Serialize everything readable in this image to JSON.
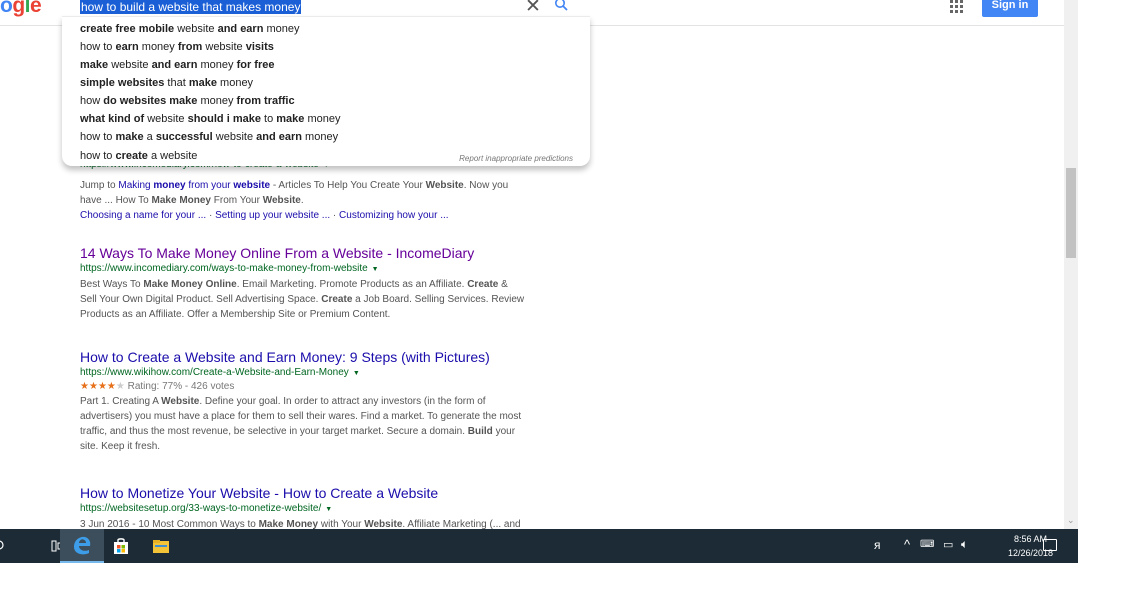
{
  "header": {
    "logo_text": "ogle",
    "search_query": "how to build a website that makes money",
    "clear_glyph": "✕",
    "signin_label": "Sign in"
  },
  "suggestions": [
    {
      "parts": [
        [
          "b",
          "create free mobile"
        ],
        [
          "n",
          " website "
        ],
        [
          "b",
          "and earn"
        ],
        [
          "n",
          " money"
        ]
      ]
    },
    {
      "parts": [
        [
          "n",
          "how to "
        ],
        [
          "b",
          "earn"
        ],
        [
          "n",
          " money "
        ],
        [
          "b",
          "from"
        ],
        [
          "n",
          " website "
        ],
        [
          "b",
          "visits"
        ]
      ]
    },
    {
      "parts": [
        [
          "b",
          "make"
        ],
        [
          "n",
          " website "
        ],
        [
          "b",
          "and earn"
        ],
        [
          "n",
          " money "
        ],
        [
          "b",
          "for free"
        ]
      ]
    },
    {
      "parts": [
        [
          "b",
          "simple websites"
        ],
        [
          "n",
          " that "
        ],
        [
          "b",
          "make"
        ],
        [
          "n",
          " money"
        ]
      ]
    },
    {
      "parts": [
        [
          "n",
          "how "
        ],
        [
          "b",
          "do websites make"
        ],
        [
          "n",
          " money "
        ],
        [
          "b",
          "from traffic"
        ]
      ]
    },
    {
      "parts": [
        [
          "b",
          "what kind of"
        ],
        [
          "n",
          " website "
        ],
        [
          "b",
          "should i make"
        ],
        [
          "n",
          " to "
        ],
        [
          "b",
          "make"
        ],
        [
          "n",
          " money"
        ]
      ]
    },
    {
      "parts": [
        [
          "n",
          "how to "
        ],
        [
          "b",
          "make"
        ],
        [
          "n",
          " a "
        ],
        [
          "b",
          "successful"
        ],
        [
          "n",
          " website "
        ],
        [
          "b",
          "and earn"
        ],
        [
          "n",
          " money"
        ]
      ]
    },
    {
      "parts": [
        [
          "n",
          "how to "
        ],
        [
          "b",
          "create"
        ],
        [
          "n",
          " a website"
        ]
      ]
    }
  ],
  "report_text": "Report inappropriate predictions",
  "results": {
    "r0": {
      "url": "https://www.incomediary.com/how-to-create-a-website",
      "snippet1_parts": [
        [
          "n",
          "Jump to "
        ],
        [
          "l",
          "Making "
        ],
        [
          "lb",
          "money"
        ],
        [
          "l",
          " from your "
        ],
        [
          "lb",
          "website"
        ],
        [
          "n",
          " - Articles To Help You Create Your "
        ],
        [
          "b",
          "Website"
        ],
        [
          "n",
          ". Now you"
        ]
      ],
      "snippet2_parts": [
        [
          "n",
          "have ... How To "
        ],
        [
          "b",
          "Make Money"
        ],
        [
          "n",
          " From Your "
        ],
        [
          "b",
          "Website"
        ],
        [
          "n",
          "."
        ]
      ],
      "sitelinks": [
        "Choosing a name for your ...",
        "Setting up your website ...",
        "Customizing how your ..."
      ],
      "sitelink_sep": " · "
    },
    "r1": {
      "title": "14 Ways To Make Money Online From a Website - IncomeDiary",
      "url": "https://www.incomediary.com/ways-to-make-money-from-website",
      "snippet_lines": [
        [
          [
            "n",
            "Best Ways To "
          ],
          [
            "b",
            "Make Money Online"
          ],
          [
            "n",
            ". Email Marketing. Promote Products as an Affiliate. "
          ],
          [
            "b",
            "Create"
          ],
          [
            "n",
            " &"
          ]
        ],
        [
          [
            "n",
            "Sell Your Own Digital Product. Sell Advertising Space. "
          ],
          [
            "b",
            "Create"
          ],
          [
            "n",
            " a Job Board. Selling Services. Review"
          ]
        ],
        [
          [
            "n",
            "Products as an Affiliate. Offer a Membership Site or Premium Content."
          ]
        ]
      ]
    },
    "r2": {
      "title": "How to Create a Website and Earn Money: 9 Steps (with Pictures)",
      "url": "https://www.wikihow.com/Create-a-Website-and-Earn-Money",
      "rating_stars": 4,
      "rating_text": "Rating: 77% - 426 votes",
      "snippet_lines": [
        [
          [
            "n",
            "Part 1. Creating A "
          ],
          [
            "b",
            "Website"
          ],
          [
            "n",
            ". Define your goal. In order to attract any investors (in the form of"
          ]
        ],
        [
          [
            "n",
            "advertisers) you must have a place for them to sell their wares. Find a market. To generate the most"
          ]
        ],
        [
          [
            "n",
            "traffic, and thus the most revenue, be selective in your target market. Secure a domain. "
          ],
          [
            "b",
            "Build"
          ],
          [
            "n",
            " your"
          ]
        ],
        [
          [
            "n",
            "site. Keep it fresh."
          ]
        ]
      ]
    },
    "r3": {
      "title": "How to Monetize Your Website - How to Create a Website",
      "url": "https://websitesetup.org/33-ways-to-monetize-website/",
      "snippet_lines": [
        [
          [
            "n",
            "3 Jun 2016 - 10 Most Common Ways to "
          ],
          [
            "b",
            "Make Money"
          ],
          [
            "n",
            " with Your "
          ],
          [
            "b",
            "Website"
          ],
          [
            "n",
            ". Affiliate Marketing (... and"
          ]
        ]
      ]
    }
  },
  "taskbar": {
    "clock_time": "8:56 AM",
    "clock_date": "12/26/2018"
  },
  "colors": {
    "link": "#1a0dab",
    "visited": "#660099",
    "url_green": "#006621",
    "highlight": "#1a5fd6",
    "taskbar": "#1c2b35",
    "signin_blue": "#4285f4"
  }
}
